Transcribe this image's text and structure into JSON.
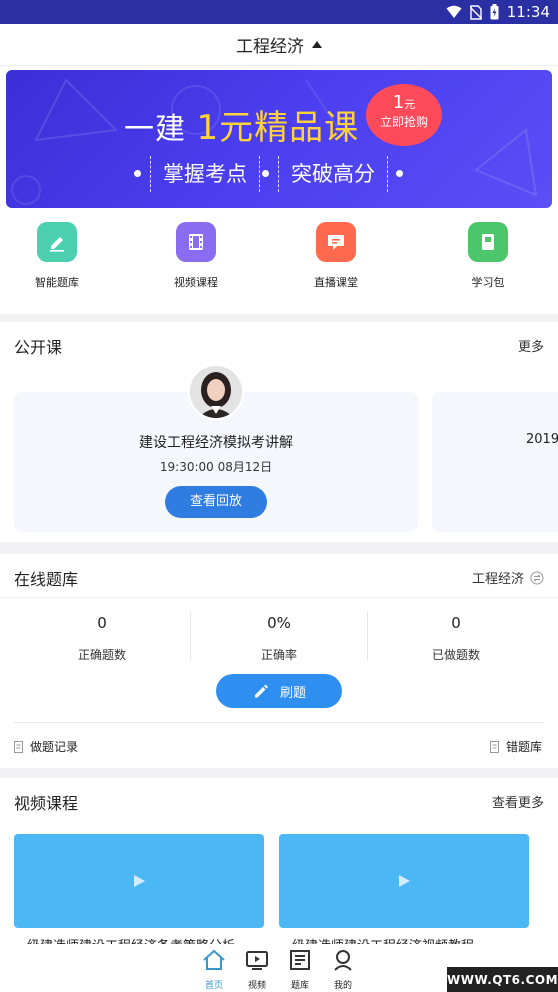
{
  "status_bar": {
    "time": "11:34"
  },
  "header": {
    "title": "工程经济"
  },
  "banner": {
    "headline_prefix": "一建",
    "headline_gold": "1元精品课",
    "badge_amount": "1",
    "badge_unit": "元",
    "badge_text": "立即抢购",
    "tag1": "掌握考点",
    "tag2": "突破高分"
  },
  "quick_nav": [
    {
      "label": "智能题库",
      "color": "#4ccfae",
      "icon": "edit-icon"
    },
    {
      "label": "视频课程",
      "color": "#8a6cf0",
      "icon": "film-icon"
    },
    {
      "label": "直播课堂",
      "color": "#ff6a4f",
      "icon": "live-chat-icon"
    },
    {
      "label": "学习包",
      "color": "#4cc66a",
      "icon": "book-icon"
    }
  ],
  "public_course": {
    "heading": "公开课",
    "more": "更多",
    "card": {
      "title": "建设工程经济模拟考讲解",
      "time": "19:30:00  08月12日",
      "button": "查看回放"
    },
    "next_card_peek": "2019"
  },
  "question_bank": {
    "heading": "在线题库",
    "filter": "工程经济",
    "stats": [
      {
        "value": "0",
        "label": "正确题数"
      },
      {
        "value": "0%",
        "label": "正确率"
      },
      {
        "value": "0",
        "label": "已做题数"
      }
    ],
    "practice_button": "刷题",
    "record_link": "做题记录",
    "wrong_link": "错题库"
  },
  "video_courses": {
    "heading": "视频课程",
    "more": "查看更多",
    "items": [
      {
        "title": "一级建造师建设工程经济备考策略分析"
      },
      {
        "title": "一级建造师建设工程经济视频教程"
      }
    ]
  },
  "tabbar": {
    "items": [
      {
        "label": "首页",
        "icon": "home-icon",
        "active": true
      },
      {
        "label": "视频",
        "icon": "tv-icon",
        "active": false
      },
      {
        "label": "题库",
        "icon": "question-bank-icon",
        "active": false
      },
      {
        "label": "我的",
        "icon": "profile-icon",
        "active": false
      }
    ]
  },
  "watermark": "WWW.QT6.COM",
  "colors": {
    "accent": "#2f8ff0",
    "banner": "#4b3ff0",
    "video_card": "#4bb8f3",
    "active_tab": "#3c97c9"
  }
}
